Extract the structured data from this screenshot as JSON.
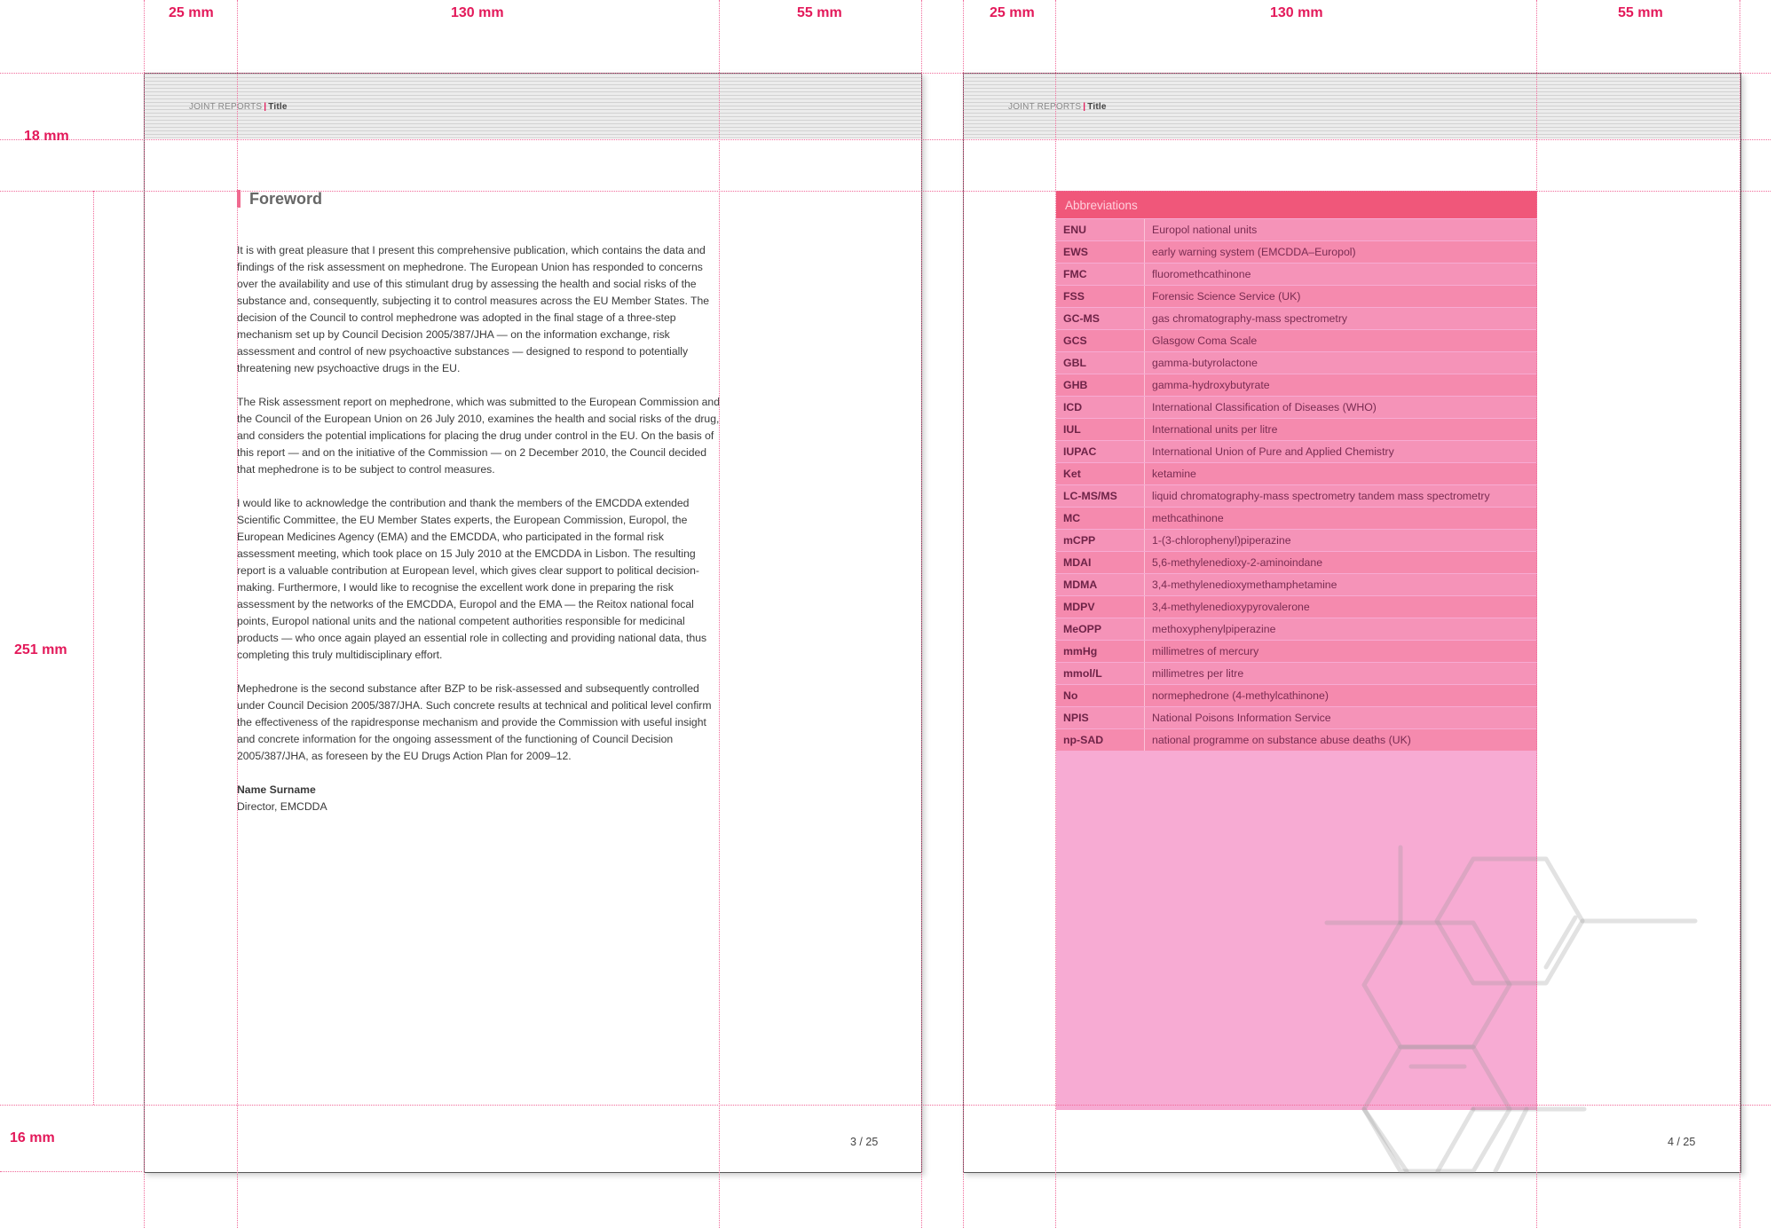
{
  "guides": {
    "top_labels": [
      "25 mm",
      "130 mm",
      "55 mm",
      "25 mm",
      "130 mm",
      "55 mm"
    ],
    "side_labels": [
      "18 mm",
      "251 mm",
      "16 mm"
    ]
  },
  "left_page": {
    "running_head": {
      "section": "JOINT REPORTS",
      "title": "Title"
    },
    "heading": "Foreword",
    "paragraphs": [
      "It is with great pleasure that I present this comprehensive publication, which contains the data and findings of the risk assessment on mephedrone. The European Union has responded to concerns over the availability and use of this stimulant drug by assessing the health and social risks of the substance and, consequently, subjecting it to control measures across the EU Member States. The decision of the Council to control mephedrone was adopted in the final stage of a three-step mechanism set up by Council Decision 2005/387/JHA — on the information exchange, risk assessment and control of new psychoactive substances — designed to respond to potentially threatening new psychoactive drugs in the EU.",
      "The Risk assessment report on mephedrone, which was submitted to the European Commission and the Council of the European Union on 26 July 2010, examines the health and social risks of the drug, and considers the potential implications for placing the drug under control in the EU. On the basis of this report — and on the initiative of the Commission — on 2 December 2010, the Council decided that mephedrone is to be subject to control measures.",
      "I would like to acknowledge the contribution and thank the members of the EMCDDA extended Scientific Committee, the EU Member States experts, the European Commission, Europol, the European Medicines Agency (EMA) and the EMCDDA, who participated in the formal risk assessment meeting, which took place on 15 July 2010 at the EMCDDA in Lisbon. The resulting report is a valuable contribution at European level, which gives clear support to political decision-making. Furthermore, I would like to recognise the excellent work done in preparing the risk assessment by the networks of the EMCDDA, Europol and the EMA — the Reitox national focal points, Europol national units and the national competent authorities responsible for medicinal products — who once again played an essential role in collecting and providing national data, thus completing this truly multidisciplinary effort.",
      "Mephedrone is the second substance after BZP to be risk-assessed and subsequently controlled under Council Decision 2005/387/JHA. Such concrete results at technical and political level confirm the effectiveness of the rapidresponse mechanism and provide the Commission with useful insight and concrete information for the ongoing assessment of the functioning of Council Decision 2005/387/JHA, as foreseen by the EU Drugs Action Plan for 2009–12."
    ],
    "signature": {
      "name": "Name Surname",
      "role": "Director, EMCDDA"
    },
    "page_number": "3 / 25"
  },
  "right_page": {
    "running_head": {
      "section": "JOINT REPORTS",
      "title": "Title"
    },
    "abbreviations": {
      "title": "Abbreviations",
      "rows": [
        {
          "code": "ENU",
          "desc": "Europol national units"
        },
        {
          "code": "EWS",
          "desc": "early warning system (EMCDDA–Europol)"
        },
        {
          "code": "FMC",
          "desc": "fluoromethcathinone"
        },
        {
          "code": "FSS",
          "desc": "Forensic Science Service (UK)"
        },
        {
          "code": "GC-MS",
          "desc": "gas chromatography-mass spectrometry"
        },
        {
          "code": "GCS",
          "desc": "Glasgow Coma Scale"
        },
        {
          "code": "GBL",
          "desc": "gamma-butyrolactone"
        },
        {
          "code": "GHB",
          "desc": "gamma-hydroxybutyrate"
        },
        {
          "code": "ICD",
          "desc": "International Classification of Diseases (WHO)"
        },
        {
          "code": "IUL",
          "desc": "International units per litre"
        },
        {
          "code": "IUPAC",
          "desc": "International Union of Pure and Applied Chemistry"
        },
        {
          "code": "Ket",
          "desc": "ketamine"
        },
        {
          "code": "LC-MS/MS",
          "desc": "liquid chromatography-mass spectrometry tandem mass spectrometry"
        },
        {
          "code": "MC",
          "desc": "methcathinone"
        },
        {
          "code": "mCPP",
          "desc": "1-(3-chlorophenyl)piperazine"
        },
        {
          "code": "MDAI",
          "desc": "5,6-methylenedioxy-2-aminoindane"
        },
        {
          "code": "MDMA",
          "desc": "3,4-methylenedioxymethamphetamine"
        },
        {
          "code": "MDPV",
          "desc": "3,4-methylenedioxypyrovalerone"
        },
        {
          "code": "MeOPP",
          "desc": "methoxyphenylpiperazine"
        },
        {
          "code": "mmHg",
          "desc": "millimetres of mercury"
        },
        {
          "code": "mmol/L",
          "desc": "millimetres per litre"
        },
        {
          "code": "No",
          "desc": "normephedrone (4-methylcathinone)"
        },
        {
          "code": "NPIS",
          "desc": "National Poisons Information Service"
        },
        {
          "code": "np-SAD",
          "desc": "national programme on substance abuse deaths (UK)"
        }
      ]
    },
    "page_number": "4 / 25"
  }
}
